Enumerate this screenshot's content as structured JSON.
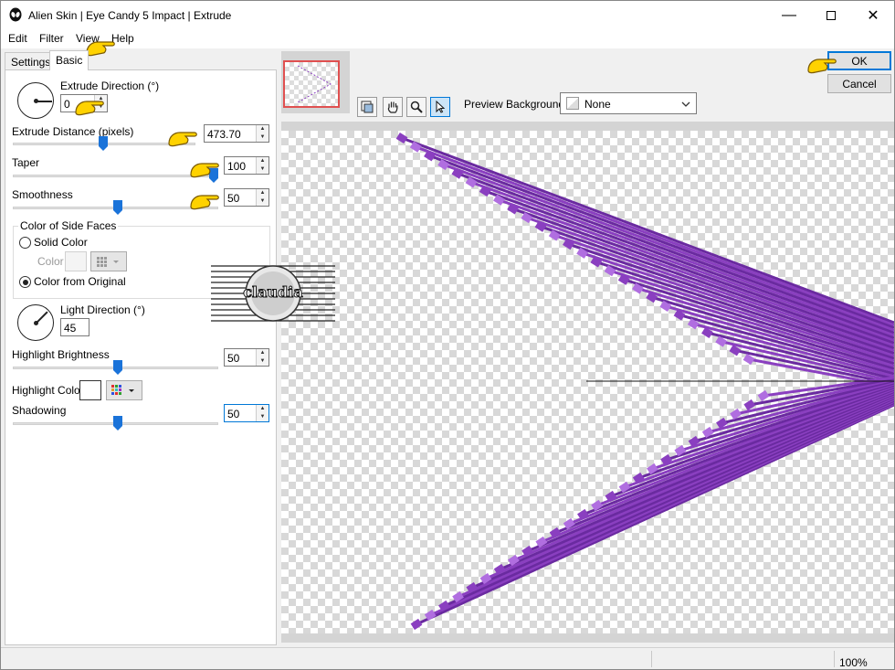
{
  "window": {
    "title": "Alien Skin | Eye Candy 5 Impact | Extrude"
  },
  "menu": [
    "Edit",
    "Filter",
    "View",
    "Help"
  ],
  "tabs": {
    "settings": "Settings",
    "basic": "Basic"
  },
  "basic": {
    "extrude_direction_label": "Extrude Direction (°)",
    "extrude_direction": "0",
    "extrude_distance_label": "Extrude Distance (pixels)",
    "extrude_distance": "473.70",
    "taper_label": "Taper",
    "taper": "100",
    "smoothness_label": "Smoothness",
    "smoothness": "50",
    "side_faces_label": "Color of Side Faces",
    "solid_color_label": "Solid Color",
    "color_label": "Color",
    "from_original_label": "Color from Original",
    "light_direction_label": "Light Direction (°)",
    "light_direction": "45",
    "highlight_brightness_label": "Highlight Brightness",
    "highlight_brightness": "50",
    "highlight_color_label": "Highlight Color",
    "shadowing_label": "Shadowing",
    "shadowing": "50"
  },
  "preview": {
    "background_label": "Preview Background:",
    "background_value": "None"
  },
  "buttons": {
    "ok": "OK",
    "cancel": "Cancel"
  },
  "status": {
    "zoom": "100%"
  },
  "watermark": {
    "text": "claudia"
  },
  "colors": {
    "accent": "#0078d7",
    "extrude": "#8a3fc0",
    "extrude_light": "#b06ee0"
  }
}
